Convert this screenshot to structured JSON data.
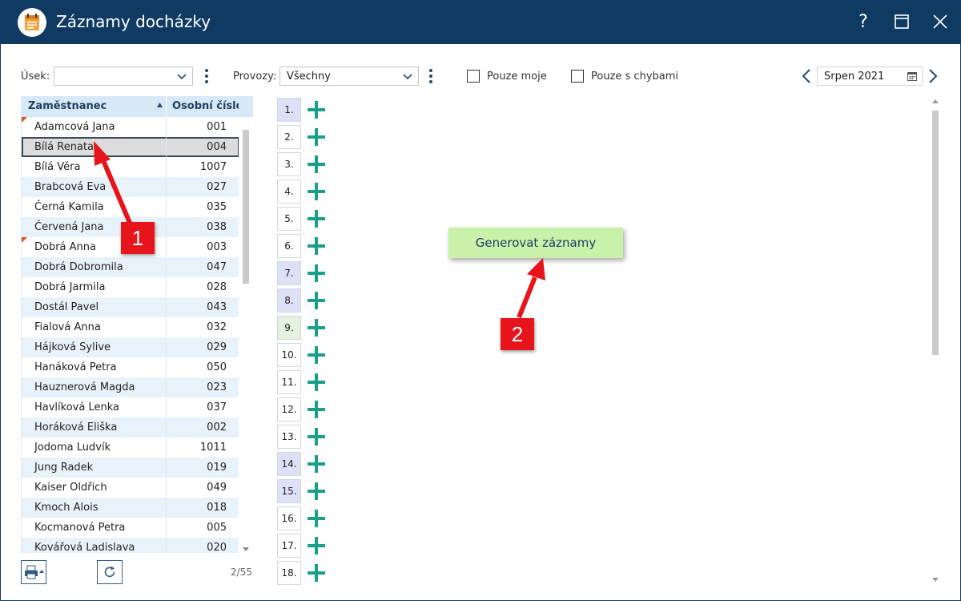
{
  "window": {
    "title": "Záznamy docházky",
    "help_label": "?",
    "colors": {
      "titlebar": "#0f3a62",
      "accent": "#1aa08a",
      "generate_bg": "#c9f1aa",
      "badge": "#e8141b"
    }
  },
  "toolbar": {
    "usek_label": "Úsek:",
    "usek_value": "",
    "provozy_label": "Provozy:",
    "provozy_value": "Všechny",
    "only_mine_label": "Pouze moje",
    "only_errors_label": "Pouze s chybami",
    "month_value": "Srpen 2021"
  },
  "grid": {
    "col_name": "Zaměstnanec",
    "col_number": "Osobní číslo",
    "rows": [
      {
        "name": "Adamcová Jana",
        "number": "001",
        "flag": true
      },
      {
        "name": "Bílá Renata",
        "number": "004",
        "selected": true
      },
      {
        "name": "Bílá Věra",
        "number": "1007"
      },
      {
        "name": "Brabcová Eva",
        "number": "027"
      },
      {
        "name": "Černá Kamila",
        "number": "035"
      },
      {
        "name": "Červená Jana",
        "number": "038"
      },
      {
        "name": "Dobrá Anna",
        "number": "003",
        "flag": true
      },
      {
        "name": "Dobrá Dobromila",
        "number": "047"
      },
      {
        "name": "Dobrá Jarmila",
        "number": "028"
      },
      {
        "name": "Dostál Pavel",
        "number": "043"
      },
      {
        "name": "Fialová Anna",
        "number": "032"
      },
      {
        "name": "Hájková Sylive",
        "number": "029"
      },
      {
        "name": "Hanáková Petra",
        "number": "050"
      },
      {
        "name": "Hauznerová Magda",
        "number": "023"
      },
      {
        "name": "Havlíková Lenka",
        "number": "037"
      },
      {
        "name": "Horáková Eliška",
        "number": "002"
      },
      {
        "name": "Jodoma Ludvík",
        "number": "1011"
      },
      {
        "name": "Jung Radek",
        "number": "019"
      },
      {
        "name": "Kaiser Oldřich",
        "number": "049"
      },
      {
        "name": "Kmoch Alois",
        "number": "018"
      },
      {
        "name": "Kocmanová Petra",
        "number": "005"
      },
      {
        "name": "Kovářová Ladislava",
        "number": "020"
      }
    ],
    "counter": "2/55"
  },
  "days": [
    {
      "label": "1.",
      "kind": "weekend"
    },
    {
      "label": "2.",
      "kind": ""
    },
    {
      "label": "3.",
      "kind": ""
    },
    {
      "label": "4.",
      "kind": ""
    },
    {
      "label": "5.",
      "kind": ""
    },
    {
      "label": "6.",
      "kind": ""
    },
    {
      "label": "7.",
      "kind": "weekend"
    },
    {
      "label": "8.",
      "kind": "weekend"
    },
    {
      "label": "9.",
      "kind": "today"
    },
    {
      "label": "10.",
      "kind": ""
    },
    {
      "label": "11.",
      "kind": ""
    },
    {
      "label": "12.",
      "kind": ""
    },
    {
      "label": "13.",
      "kind": ""
    },
    {
      "label": "14.",
      "kind": "weekend"
    },
    {
      "label": "15.",
      "kind": "weekend"
    },
    {
      "label": "16.",
      "kind": ""
    },
    {
      "label": "17.",
      "kind": ""
    },
    {
      "label": "18.",
      "kind": ""
    }
  ],
  "generate_button": "Generovat záznamy",
  "badges": {
    "one": "1",
    "two": "2"
  }
}
